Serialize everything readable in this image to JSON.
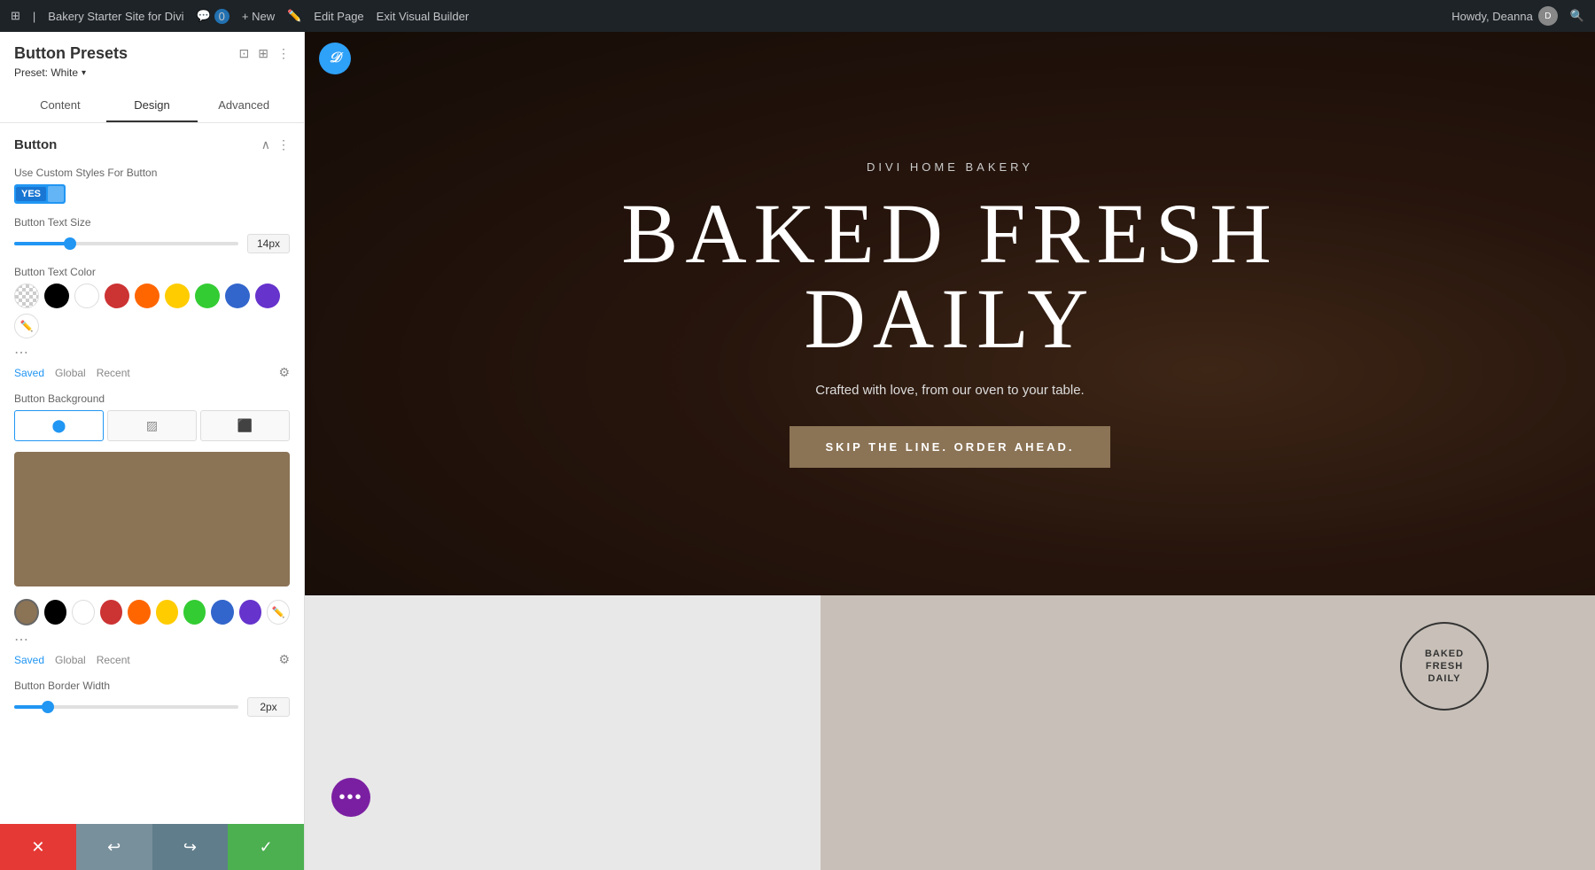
{
  "admin_bar": {
    "wp_logo": "⊞",
    "site_name": "Bakery Starter Site for Divi",
    "comments_icon": "💬",
    "comments_count": "0",
    "new_label": "+ New",
    "edit_page_label": "Edit Page",
    "exit_builder_label": "Exit Visual Builder",
    "howdy_label": "Howdy, Deanna",
    "search_icon": "🔍"
  },
  "panel": {
    "title": "Button Presets",
    "preset_label": "Preset: White",
    "preset_arrow": "▾",
    "tabs": [
      {
        "id": "content",
        "label": "Content"
      },
      {
        "id": "design",
        "label": "Design"
      },
      {
        "id": "advanced",
        "label": "Advanced"
      }
    ],
    "active_tab": "design",
    "icons": {
      "duplicate": "⊡",
      "grid": "⊞",
      "more": "⋮",
      "collapse": "∧",
      "dots": "⋯"
    }
  },
  "button_section": {
    "title": "Button",
    "toggle_label": "Use Custom Styles For Button",
    "toggle_value": "YES",
    "text_size_label": "Button Text Size",
    "text_size_value": "14px",
    "text_size_slider_percent": 25,
    "text_color_label": "Button Text Color",
    "colors": [
      {
        "id": "transparent",
        "type": "transparent"
      },
      {
        "id": "black",
        "hex": "#000000"
      },
      {
        "id": "white",
        "hex": "#ffffff"
      },
      {
        "id": "red",
        "hex": "#CC3333"
      },
      {
        "id": "orange",
        "hex": "#FF6600"
      },
      {
        "id": "yellow",
        "hex": "#FFCC00"
      },
      {
        "id": "green",
        "hex": "#33CC33"
      },
      {
        "id": "blue",
        "hex": "#3366CC"
      },
      {
        "id": "purple",
        "hex": "#6633CC"
      },
      {
        "id": "custom",
        "type": "custom"
      }
    ],
    "color_tabs": [
      "Saved",
      "Global",
      "Recent"
    ],
    "bg_label": "Button Background",
    "bg_types": [
      {
        "id": "solid",
        "icon": "⬜",
        "active": true
      },
      {
        "id": "gradient",
        "icon": "▨"
      },
      {
        "id": "image",
        "icon": "🖼"
      }
    ],
    "bg_color_hex": "#8B7355",
    "bg_color_preview": "#8B7355",
    "bg_bottom_colors": [
      {
        "id": "transparent",
        "type": "transparent"
      },
      {
        "id": "black",
        "hex": "#000000"
      },
      {
        "id": "white",
        "hex": "#ffffff"
      },
      {
        "id": "red",
        "hex": "#CC3333"
      },
      {
        "id": "orange",
        "hex": "#FF6600"
      },
      {
        "id": "yellow",
        "hex": "#FFCC00"
      },
      {
        "id": "green",
        "hex": "#33CC33"
      },
      {
        "id": "blue",
        "hex": "#3366CC"
      },
      {
        "id": "purple",
        "hex": "#6633CC"
      },
      {
        "id": "custom2",
        "type": "custom"
      }
    ],
    "border_width_label": "Button Border Width",
    "border_width_value": "2px",
    "border_width_slider_percent": 15
  },
  "hero": {
    "subtitle": "DIVI HOME BAKERY",
    "title_line1": "BAKED FRESH",
    "title_line2": "DAILY",
    "description": "Crafted with love, from our oven to your table.",
    "button_text": "SKIP THE LINE. ORDER AHEAD."
  },
  "bottom_preview": {
    "stamp_text": "BAKED\nFRESH\nDAILY"
  },
  "bottom_bar": {
    "cancel_icon": "✕",
    "undo_icon": "↩",
    "redo_icon": "↪",
    "save_icon": "✓"
  }
}
